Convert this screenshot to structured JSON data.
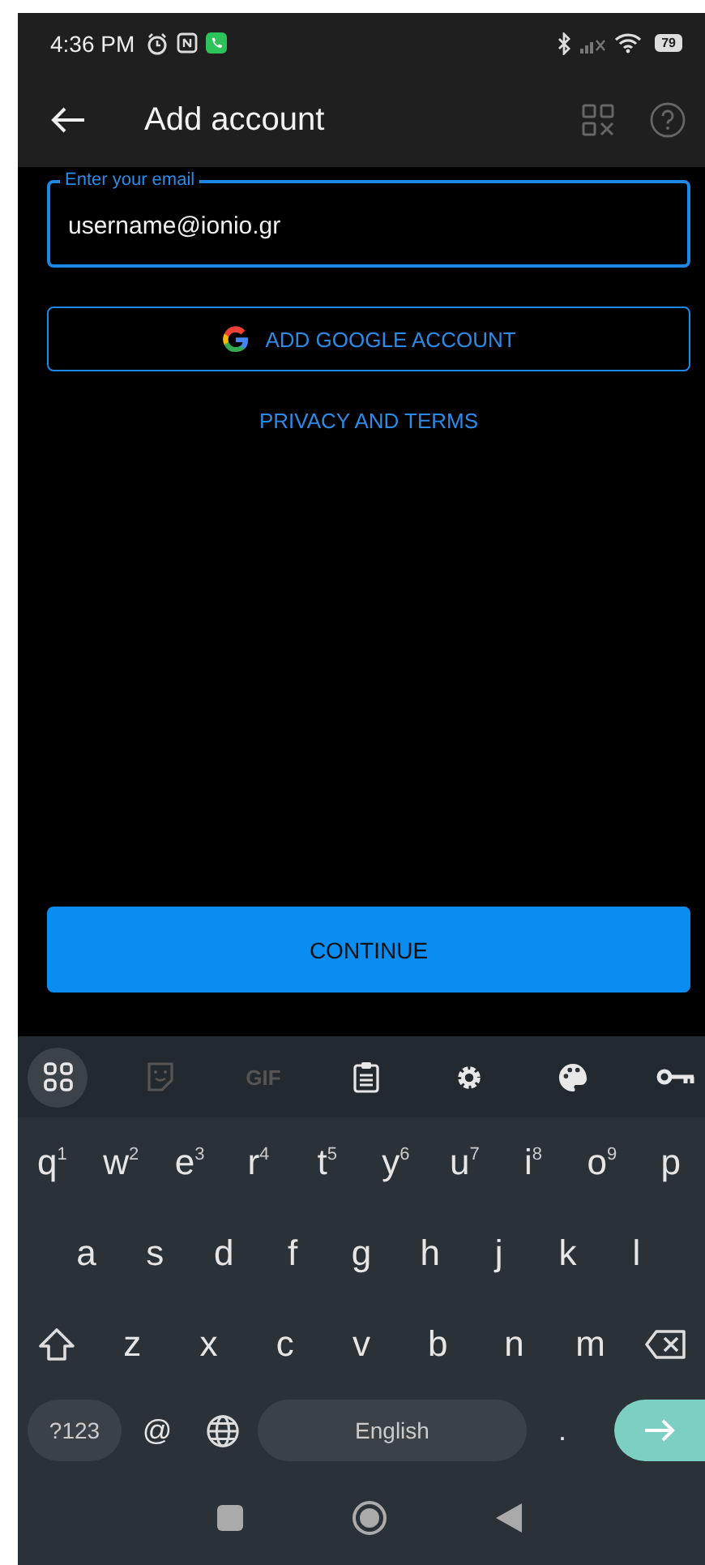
{
  "status_bar": {
    "time": "4:36 PM",
    "battery": "79"
  },
  "app_bar": {
    "title": "Add account"
  },
  "email_field": {
    "label": "Enter your email",
    "value": "username@ionio.gr"
  },
  "google_button": {
    "label": "ADD GOOGLE ACCOUNT"
  },
  "privacy_link": {
    "label": "PRIVACY AND TERMS"
  },
  "continue_button": {
    "label": "CONTINUE"
  },
  "keyboard": {
    "toolbar": [
      {
        "kind": "grid",
        "selected": true,
        "disabled": false
      },
      {
        "kind": "sticker",
        "selected": false,
        "disabled": true
      },
      {
        "kind": "gif",
        "label": "GIF",
        "selected": false,
        "disabled": true
      },
      {
        "kind": "clipboard",
        "selected": false,
        "disabled": false
      },
      {
        "kind": "gear",
        "selected": false,
        "disabled": false
      },
      {
        "kind": "palette",
        "selected": false,
        "disabled": false
      },
      {
        "kind": "key",
        "selected": false,
        "disabled": false
      }
    ],
    "row1": [
      {
        "letter": "q",
        "hint": "1"
      },
      {
        "letter": "w",
        "hint": "2"
      },
      {
        "letter": "e",
        "hint": "3"
      },
      {
        "letter": "r",
        "hint": "4"
      },
      {
        "letter": "t",
        "hint": "5"
      },
      {
        "letter": "y",
        "hint": "6"
      },
      {
        "letter": "u",
        "hint": "7"
      },
      {
        "letter": "i",
        "hint": "8"
      },
      {
        "letter": "o",
        "hint": "9"
      },
      {
        "letter": "p"
      }
    ],
    "row2": [
      "a",
      "s",
      "d",
      "f",
      "g",
      "h",
      "j",
      "k",
      "l"
    ],
    "row3": [
      "z",
      "x",
      "c",
      "v",
      "b",
      "n",
      "m"
    ],
    "symbols_key": "?123",
    "at_key": "@",
    "space_key": "English",
    "period_key": "."
  }
}
